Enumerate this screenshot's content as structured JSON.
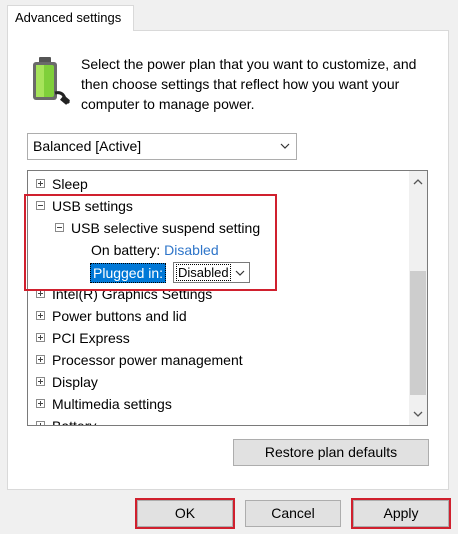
{
  "tab": {
    "label": "Advanced settings"
  },
  "description": "Select the power plan that you want to customize, and then choose settings that reflect how you want your computer to manage power.",
  "plan_select": {
    "value": "Balanced [Active]"
  },
  "tree": {
    "sleep": "Sleep",
    "usb_settings": "USB settings",
    "usb_selective": "USB selective suspend setting",
    "on_battery_label": "On battery:",
    "on_battery_value": "Disabled",
    "plugged_in_label": "Plugged in:",
    "plugged_in_value": "Disabled",
    "intel": "Intel(R) Graphics Settings",
    "power_buttons": "Power buttons and lid",
    "pci": "PCI Express",
    "processor": "Processor power management",
    "display": "Display",
    "multimedia": "Multimedia settings",
    "battery": "Battery"
  },
  "buttons": {
    "restore": "Restore plan defaults",
    "ok": "OK",
    "cancel": "Cancel",
    "apply": "Apply"
  },
  "colors": {
    "link": "#2e75c9",
    "selection": "#0078d7",
    "highlight_border": "#d0202e"
  }
}
